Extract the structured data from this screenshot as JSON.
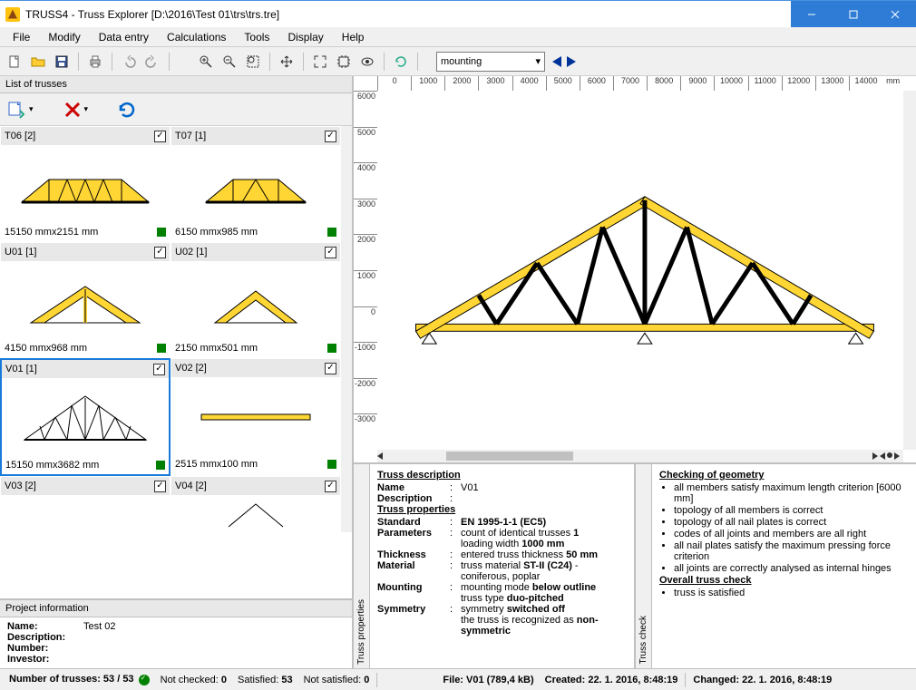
{
  "window": {
    "title": "TRUSS4 - Truss Explorer [D:\\2016\\Test 01\\trs\\trs.tre]"
  },
  "menu": [
    "File",
    "Modify",
    "Data entry",
    "Calculations",
    "Tools",
    "Display",
    "Help"
  ],
  "combo": {
    "value": "mounting"
  },
  "left": {
    "header": "List of trusses",
    "project_header": "Project information",
    "project": {
      "name_label": "Name",
      "name": "Test 02",
      "desc_label": "Description",
      "desc": "",
      "num_label": "Number",
      "num": "",
      "inv_label": "Investor",
      "inv": ""
    },
    "trusses": [
      {
        "name": "T06 [2]",
        "dim": "15150 mmx2151 mm",
        "checked": true
      },
      {
        "name": "T07 [1]",
        "dim": "6150 mmx985 mm",
        "checked": true
      },
      {
        "name": "U01 [1]",
        "dim": "4150 mmx968 mm",
        "checked": true
      },
      {
        "name": "U02 [1]",
        "dim": "2150 mmx501 mm",
        "checked": true
      },
      {
        "name": "V01 [1]",
        "dim": "15150 mmx3682 mm",
        "checked": true,
        "selected": true
      },
      {
        "name": "V02 [2]",
        "dim": "2515 mmx100 mm",
        "checked": true
      },
      {
        "name": "V03 [2]",
        "dim": "",
        "checked": true
      },
      {
        "name": "V04 [2]",
        "dim": "",
        "checked": true
      }
    ]
  },
  "ruler_h": [
    "0",
    "1000",
    "2000",
    "3000",
    "4000",
    "5000",
    "6000",
    "7000",
    "8000",
    "9000",
    "10000",
    "11000",
    "12000",
    "13000",
    "14000"
  ],
  "ruler_h_unit": "mm",
  "ruler_v": [
    "6000",
    "5000",
    "4000",
    "3000",
    "2000",
    "1000",
    "0",
    "-1000",
    "-2000",
    "-3000"
  ],
  "details": {
    "left_tab": "Truss properties",
    "right_tab": "Truss check",
    "desc_hdr": "Truss description",
    "name_label": "Name",
    "name_val": "V01",
    "descr_label": "Description",
    "descr_val": "",
    "props_hdr": "Truss properties",
    "std_label": "Standard",
    "std_val": "EN 1995-1-1 (EC5)",
    "param_label": "Parameters",
    "param_l1a": "count of identical trusses ",
    "param_l1b": "1",
    "param_l2a": "loading width ",
    "param_l2b": "1000 mm",
    "thick_label": "Thickness",
    "thick_a": "entered truss thickness ",
    "thick_b": "50 mm",
    "mat_label": "Material",
    "mat_l1a": "truss material ",
    "mat_l1b": "ST-II (C24)",
    "mat_l1c": " - coniferous, poplar",
    "mount_label": "Mounting",
    "mount_l1a": "mounting mode ",
    "mount_l1b": "below outline",
    "mount_l2a": "truss type ",
    "mount_l2b": "duo-pitched",
    "sym_label": "Symmetry",
    "sym_l1a": "symmetry ",
    "sym_l1b": "switched off",
    "sym_l2a": "the truss is recognized as ",
    "sym_l2b": "non-symmetric",
    "chk_hdr": "Checking of geometry",
    "chk_items": [
      "all members satisfy maximum length criterion [6000 mm]",
      "topology of all members is correct",
      "topology of all nail plates is correct",
      "codes of all joints and members are all right",
      "all nail plates satisfy the maximum pressing force criterion",
      "all joints are correctly analysed as internal hinges"
    ],
    "overall_hdr": "Overall truss check",
    "overall_item": "truss is satisfied"
  },
  "status": {
    "count": "Number of trusses: 53 / 53",
    "notchk_lbl": "Not checked:",
    "notchk": "0",
    "sat_lbl": "Satisfied:",
    "sat": "53",
    "nsat_lbl": "Not satisfied:",
    "nsat": "0",
    "file": "File: V01 (789,4 kB)",
    "created": "Created: 22. 1. 2016, 8:48:19",
    "changed": "Changed: 22. 1. 2016, 8:48:19"
  }
}
